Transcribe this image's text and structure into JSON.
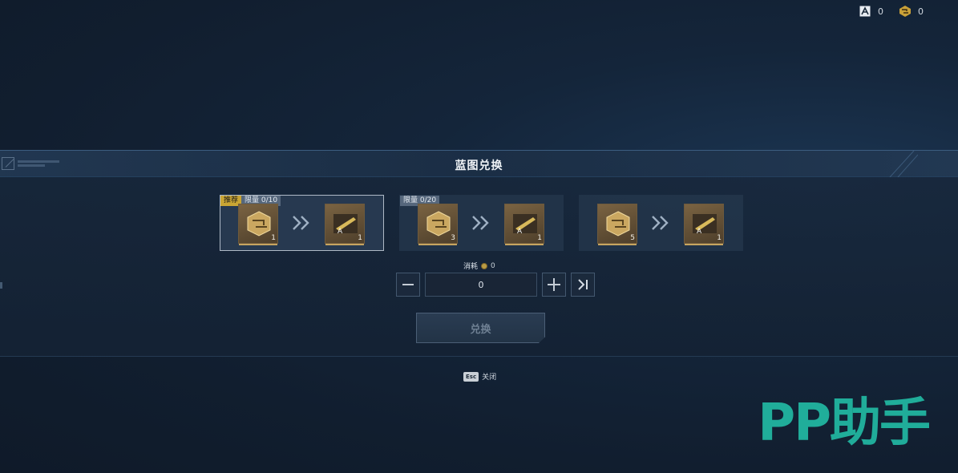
{
  "currencies": [
    {
      "icon": "crystal-a-icon",
      "value": "0"
    },
    {
      "icon": "gold-box-icon",
      "value": "0"
    }
  ],
  "dialog": {
    "title": "蓝图兑换"
  },
  "offers": [
    {
      "tags": [
        "推荐",
        "限量 0/10"
      ],
      "cost_qty": "1",
      "reward_qty": "1",
      "selected": true
    },
    {
      "tags": [
        "限量 0/20"
      ],
      "cost_qty": "3",
      "reward_qty": "1",
      "selected": false
    },
    {
      "tags": [],
      "cost_qty": "5",
      "reward_qty": "1",
      "selected": false
    }
  ],
  "consume": {
    "label": "消耗",
    "value": "0"
  },
  "stepper": {
    "value": "0"
  },
  "exchange_button": "兑换",
  "close_hint": {
    "key": "Esc",
    "label": "关闭"
  },
  "watermark": "PP助手",
  "colors": {
    "accent_gold": "#c9a534",
    "watermark": "#22b9a3"
  }
}
